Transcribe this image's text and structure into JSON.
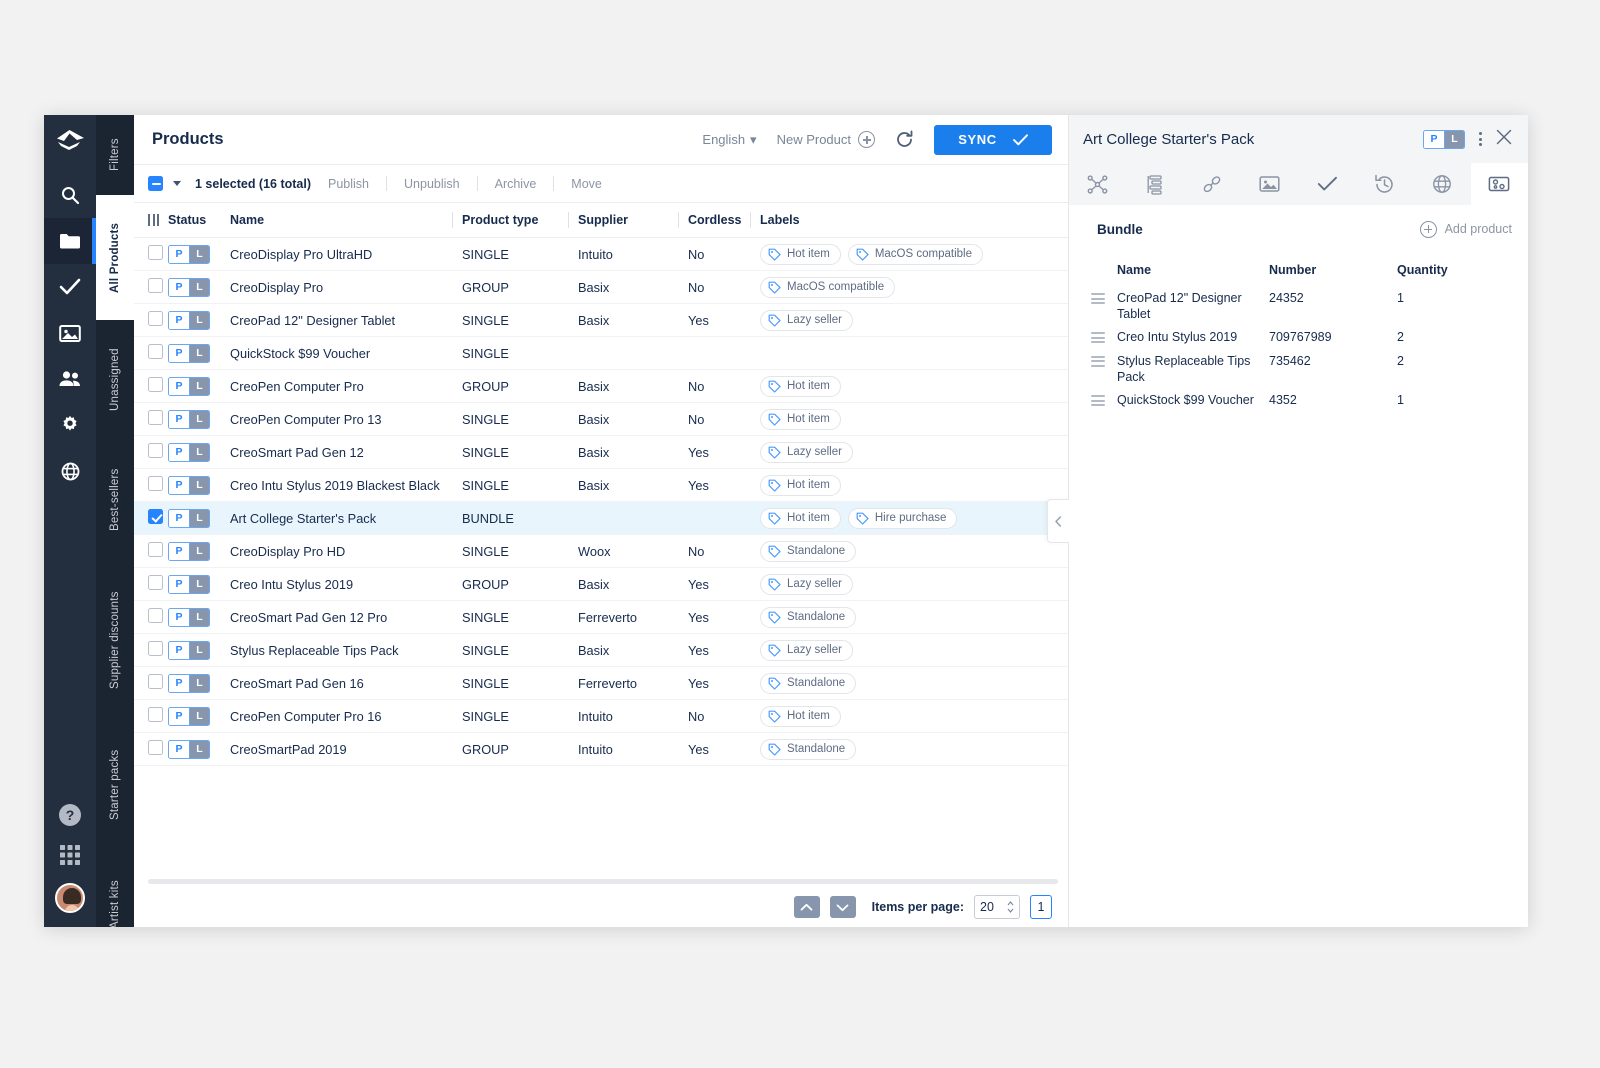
{
  "rail": {
    "icons": [
      {
        "name": "app-logo",
        "glyph": "logo"
      },
      {
        "name": "search-icon",
        "glyph": "search"
      },
      {
        "name": "folder-icon",
        "glyph": "folder"
      },
      {
        "name": "check-icon",
        "glyph": "check"
      },
      {
        "name": "image-icon",
        "glyph": "image"
      },
      {
        "name": "users-icon",
        "glyph": "users"
      },
      {
        "name": "gear-icon",
        "glyph": "gear"
      },
      {
        "name": "globe-icon",
        "glyph": "globe"
      }
    ],
    "bottom": [
      {
        "name": "help-icon",
        "glyph": "help"
      },
      {
        "name": "apps-grid-icon",
        "glyph": "grid"
      },
      {
        "name": "avatar",
        "glyph": "avatar"
      }
    ]
  },
  "vtabs": [
    {
      "label": "Filters",
      "active": false
    },
    {
      "label": "All Products",
      "active": true
    },
    {
      "label": "Unassigned",
      "active": false
    },
    {
      "label": "Best-sellers",
      "active": false
    },
    {
      "label": "Supplier discounts",
      "active": false
    },
    {
      "label": "Starter packs",
      "active": false
    },
    {
      "label": "Artist kits",
      "active": false
    }
  ],
  "header": {
    "title": "Products",
    "language": "English",
    "language_caret": "▾",
    "new_product": "New Product",
    "sync": "SYNC"
  },
  "toolbar": {
    "selection": "1 selected (16 total)",
    "publish": "Publish",
    "unpublish": "Unpublish",
    "archive": "Archive",
    "move": "Move"
  },
  "table": {
    "columns": [
      "Status",
      "Name",
      "Product type",
      "Supplier",
      "Cordless",
      "Labels"
    ],
    "status_badge": {
      "p": "P",
      "l": "L"
    },
    "rows": [
      {
        "name": "CreoDisplay Pro UltraHD",
        "type": "SINGLE",
        "supplier": "Intuito",
        "cordless": "No",
        "labels": [
          "Hot item",
          "MacOS compatible"
        ],
        "selected": false
      },
      {
        "name": "CreoDisplay Pro",
        "type": "GROUP",
        "supplier": "Basix",
        "cordless": "No",
        "labels": [
          "MacOS compatible"
        ],
        "selected": false
      },
      {
        "name": "CreoPad 12\" Designer Tablet",
        "type": "SINGLE",
        "supplier": "Basix",
        "cordless": "Yes",
        "labels": [
          "Lazy seller"
        ],
        "selected": false
      },
      {
        "name": "QuickStock $99 Voucher",
        "type": "SINGLE",
        "supplier": "",
        "cordless": "",
        "labels": [],
        "selected": false
      },
      {
        "name": "CreoPen Computer Pro",
        "type": "GROUP",
        "supplier": "Basix",
        "cordless": "No",
        "labels": [
          "Hot item"
        ],
        "selected": false
      },
      {
        "name": "CreoPen Computer Pro 13",
        "type": "SINGLE",
        "supplier": "Basix",
        "cordless": "No",
        "labels": [
          "Hot item"
        ],
        "selected": false
      },
      {
        "name": "CreoSmart Pad Gen 12",
        "type": "SINGLE",
        "supplier": "Basix",
        "cordless": "Yes",
        "labels": [
          "Lazy seller"
        ],
        "selected": false
      },
      {
        "name": "Creo Intu Stylus 2019 Blackest Black",
        "type": "SINGLE",
        "supplier": "Basix",
        "cordless": "Yes",
        "labels": [
          "Hot item"
        ],
        "selected": false
      },
      {
        "name": "Art College Starter's Pack",
        "type": "BUNDLE",
        "supplier": "",
        "cordless": "",
        "labels": [
          "Hot item",
          "Hire purchase"
        ],
        "selected": true
      },
      {
        "name": "CreoDisplay Pro HD",
        "type": "SINGLE",
        "supplier": "Woox",
        "cordless": "No",
        "labels": [
          "Standalone"
        ],
        "selected": false
      },
      {
        "name": "Creo Intu Stylus 2019",
        "type": "GROUP",
        "supplier": "Basix",
        "cordless": "Yes",
        "labels": [
          "Lazy seller"
        ],
        "selected": false
      },
      {
        "name": "CreoSmart Pad Gen 12 Pro",
        "type": "SINGLE",
        "supplier": "Ferreverto",
        "cordless": "Yes",
        "labels": [
          "Standalone"
        ],
        "selected": false
      },
      {
        "name": "Stylus Replaceable Tips Pack",
        "type": "SINGLE",
        "supplier": "Basix",
        "cordless": "Yes",
        "labels": [
          "Lazy seller"
        ],
        "selected": false
      },
      {
        "name": "CreoSmart Pad Gen 16",
        "type": "SINGLE",
        "supplier": "Ferreverto",
        "cordless": "Yes",
        "labels": [
          "Standalone"
        ],
        "selected": false
      },
      {
        "name": "CreoPen Computer Pro 16",
        "type": "SINGLE",
        "supplier": "Intuito",
        "cordless": "No",
        "labels": [
          "Hot item"
        ],
        "selected": false
      },
      {
        "name": "CreoSmartPad 2019",
        "type": "GROUP",
        "supplier": "Intuito",
        "cordless": "Yes",
        "labels": [
          "Standalone"
        ],
        "selected": false
      }
    ]
  },
  "footer": {
    "items_per_page_label": "Items per page:",
    "items_per_page_value": "20",
    "page_value": "1"
  },
  "panel": {
    "title": "Art College Starter's Pack",
    "status_badge": {
      "p": "P",
      "l": "L"
    },
    "tabs": [
      {
        "name": "relations-icon",
        "active": false
      },
      {
        "name": "attributes-icon",
        "active": false
      },
      {
        "name": "link-icon",
        "active": false
      },
      {
        "name": "media-icon",
        "active": false
      },
      {
        "name": "completeness-check-icon",
        "active": false
      },
      {
        "name": "history-icon",
        "active": false
      },
      {
        "name": "channels-globe-icon",
        "active": false
      },
      {
        "name": "bundle-icon",
        "active": true
      }
    ],
    "section_title": "Bundle",
    "add_product": "Add product",
    "bundle_columns": [
      "Name",
      "Number",
      "Quantity"
    ],
    "bundle_rows": [
      {
        "name": "CreoPad 12\" Designer Tablet",
        "number": "24352",
        "quantity": "1"
      },
      {
        "name": "Creo Intu Stylus 2019",
        "number": "709767989",
        "quantity": "2"
      },
      {
        "name": "Stylus Replaceable Tips Pack",
        "number": "735462",
        "quantity": "2"
      },
      {
        "name": "QuickStock $99 Voucher",
        "number": "4352",
        "quantity": "1"
      }
    ]
  },
  "colors": {
    "accent": "#2684ff",
    "sync_button": "#1a7fec",
    "rail_bg": "#232f3e",
    "vtab_bg": "#1b2431",
    "selected_row": "#e9f5fd"
  }
}
